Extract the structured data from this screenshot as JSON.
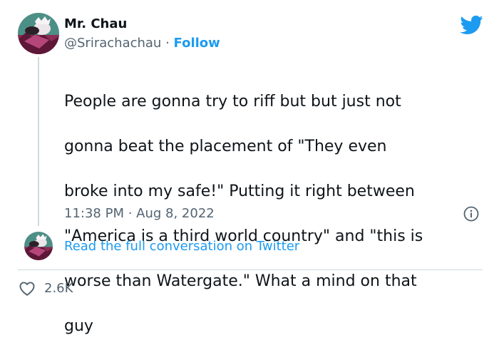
{
  "author": {
    "name": "Mr. Chau",
    "handle": "@Srirachachau",
    "separator": " · ",
    "follow_label": "Follow"
  },
  "tweet": {
    "text_lines": [
      "People are gonna try to riff but but just not",
      "gonna beat the placement of \"They even",
      "broke into my safe!\" Putting it right between",
      "\"America is a third world country\" and \"this is",
      "worse than Watergate.\" What a mind on that",
      "guy"
    ],
    "time": "11:38 PM",
    "date": "Aug 8, 2022",
    "time_separator": " · "
  },
  "actions": {
    "read_conversation_label": "Read the full conversation on Twitter",
    "like_count": "2.6K"
  },
  "icons": {
    "brand": "twitter-bird-icon",
    "info": "info-icon",
    "like": "heart-icon",
    "avatar": "avatar-image"
  },
  "colors": {
    "brand_blue": "#1d9bf0",
    "text_primary": "#0f1419",
    "text_secondary": "#536471",
    "divider": "#cfd9de"
  }
}
